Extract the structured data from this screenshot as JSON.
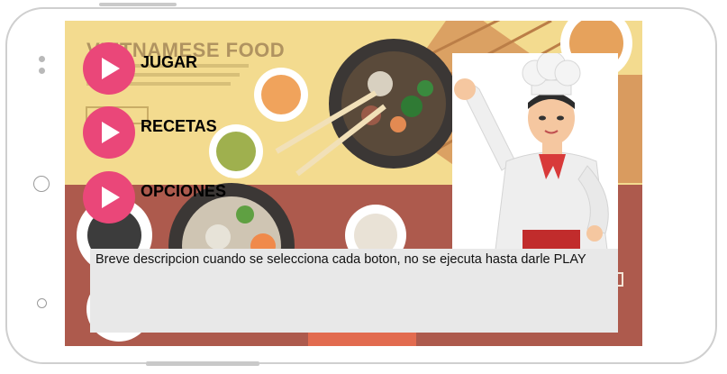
{
  "banner": {
    "title": "VIETNAMESE FOOD"
  },
  "menu": {
    "items": [
      {
        "label": "JUGAR",
        "icon": "play-icon"
      },
      {
        "label": "RECETAS",
        "icon": "play-icon"
      },
      {
        "label": "OPCIONES",
        "icon": "play-icon"
      }
    ]
  },
  "description": {
    "text": "Breve descripcion cuando se selecciona cada boton, no se ejecuta hasta darle PLAY"
  },
  "colors": {
    "accent": "#ea4779",
    "top_background": "#f3db8f",
    "bottom_background": "#ad5a4d",
    "description_background": "#e8e8e8"
  },
  "images": {
    "character": "chef-illustration",
    "background": "vietnamese-food-illustration"
  }
}
